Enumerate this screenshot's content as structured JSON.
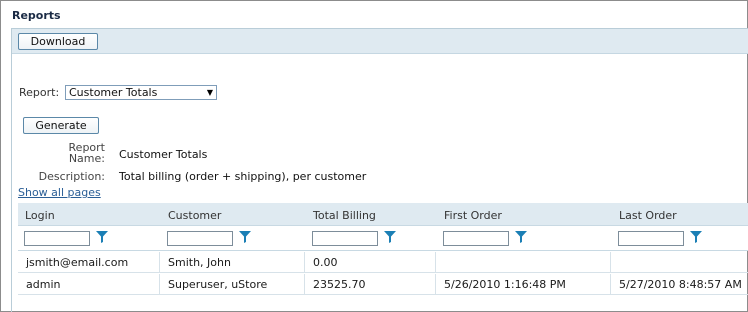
{
  "page": {
    "title": "Reports"
  },
  "toolbar": {
    "download_label": "Download"
  },
  "report_select": {
    "label": "Report:",
    "value": "Customer Totals"
  },
  "generate_label": "Generate",
  "report_name": {
    "label_line1": "Report",
    "label_line2": "Name:",
    "value": "Customer Totals"
  },
  "description": {
    "label": "Description:",
    "value": "Total billing (order + shipping), per customer"
  },
  "show_all_label": "Show all pages",
  "grid": {
    "columns": [
      "Login",
      "Customer",
      "Total Billing",
      "First Order",
      "Last Order"
    ],
    "rows": [
      [
        "jsmith@email.com",
        "Smith, John",
        "0.00",
        "",
        ""
      ],
      [
        "admin",
        "Superuser, uStore",
        "23525.70",
        "5/26/2010 1:16:48 PM",
        "5/27/2010 8:48:57 AM"
      ]
    ],
    "filter_icon": "funnel-filter-icon",
    "accent_color": "#1b7fb5"
  }
}
